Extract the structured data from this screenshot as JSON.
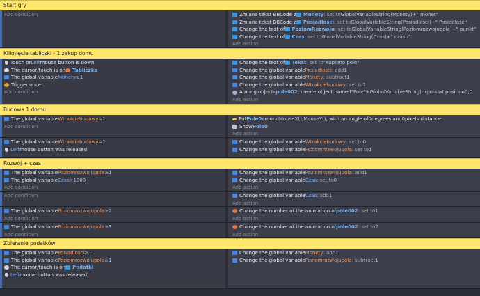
{
  "groups": [
    {
      "title": "Start gry"
    },
    {
      "title": "Kliknięcie tabliczki - 1 zakup domu"
    },
    {
      "title": "Budowa 1 domu"
    },
    {
      "title": "Rozwój + czas"
    },
    {
      "title": "Zbieranie podatków"
    }
  ],
  "labels": {
    "add_condition": "Add condition",
    "add_action": "Add action"
  },
  "events": {
    "e1": {
      "actions": [
        [
          "Zmiana tekst BBCode z ",
          "Monety",
          ": set to ",
          "GlobalVariableString(Monety)+\" monet\""
        ],
        [
          "Zmiana tekst BBCode z ",
          "Posiadlosci",
          ": set to ",
          "GlobalVariableString(Posiadlosci)+\" Posiadłości\""
        ],
        [
          "Change the text of ",
          "PoziomRozwoju",
          ": set to ",
          "GlobalVariableString(Poziomrozwojupola)+\" punkt\""
        ],
        [
          "Change the text of ",
          "Czas",
          ": set to ",
          "GlobalVariableString(Czas)+\" czasu\""
        ]
      ]
    },
    "e2": {
      "conditions": [
        [
          "Touch or ",
          "Left",
          " mouse button is down"
        ],
        [
          "The cursor/touch is on ",
          "Tabliczka"
        ],
        [
          "The global variable ",
          "Monety",
          " ≥ ",
          "1"
        ],
        [
          "Trigger once"
        ]
      ],
      "actions": [
        [
          "Change the text of ",
          "Tekst",
          ": set to ",
          "\"Kupiono pole\""
        ],
        [
          "Change the global variable ",
          "Posiadlosci",
          ": add ",
          "1"
        ],
        [
          "Change the global variable ",
          "Monety",
          ": subtract ",
          "1"
        ],
        [
          "Change the global variable ",
          "Wtrakciebudowy",
          ": set to ",
          "1"
        ],
        [
          "Among objects ",
          "pole002",
          ", create object named ",
          "\"Pole\"+GlobalVariableString(nrpola)",
          " at position ",
          "0;0"
        ]
      ]
    },
    "e3": {
      "conditions": [
        [
          "The global variable ",
          "Wtrakciebudowy",
          " = ",
          "1"
        ]
      ],
      "actions": [
        [
          "Put ",
          "Pole0",
          " around ",
          "MouseX();MouseY()",
          ", with an angle of ",
          "0",
          " degrees and ",
          "0",
          " pixels distance."
        ],
        [
          "Show ",
          "Pole0"
        ]
      ]
    },
    "e4": {
      "conditions": [
        [
          "The global variable ",
          "Wtrakciebudowy",
          " = ",
          "1"
        ],
        [
          "Left",
          " mouse button was released"
        ]
      ],
      "actions": [
        [
          "Change the global variable ",
          "Wtrakciebudowy",
          ": set to ",
          "0"
        ],
        [
          "Change the global variable ",
          "Poziomrozwojupola",
          ": set to ",
          "1"
        ]
      ]
    },
    "e5": {
      "conditions": [
        [
          "The global variable ",
          "Poziomrozwojupola",
          " ≥ ",
          "1"
        ],
        [
          "The global variable ",
          "Czas",
          " > ",
          "1000"
        ]
      ],
      "actions": [
        [
          "Change the global variable ",
          "Poziomrozwojupola",
          ": add ",
          "1"
        ],
        [
          "Change the global variable ",
          "Czas",
          ": set to ",
          "0"
        ]
      ]
    },
    "e6": {
      "actions": [
        [
          "Change the global variable ",
          "Czas",
          ": add ",
          "1"
        ]
      ]
    },
    "e7": {
      "conditions": [
        [
          "The global variable ",
          "Poziomrozwojupola",
          " > ",
          "2"
        ]
      ],
      "actions": [
        [
          "Change the number of the animation of ",
          "pole002",
          ": set to ",
          "1"
        ]
      ]
    },
    "e8": {
      "conditions": [
        [
          "The global variable ",
          "Poziomrozwojupola",
          " > ",
          "3"
        ]
      ],
      "actions": [
        [
          "Change the number of the animation of ",
          "pole002",
          ": set to ",
          "2"
        ]
      ]
    },
    "e9": {
      "conditions": [
        [
          "The global variable ",
          "Posiadlosci",
          " ≥ ",
          "1"
        ],
        [
          "The global variable ",
          "Poziomrozwojupola",
          " ≥ ",
          "1"
        ],
        [
          "The cursor/touch is on ",
          "Podatki"
        ],
        [
          "Left",
          " mouse button was released"
        ]
      ],
      "actions": [
        [
          "Change the global variable ",
          "Monety",
          ": add ",
          "1"
        ],
        [
          "Change the global variable ",
          "Poziomrozwojupola",
          ": subtract ",
          "1"
        ]
      ]
    }
  }
}
